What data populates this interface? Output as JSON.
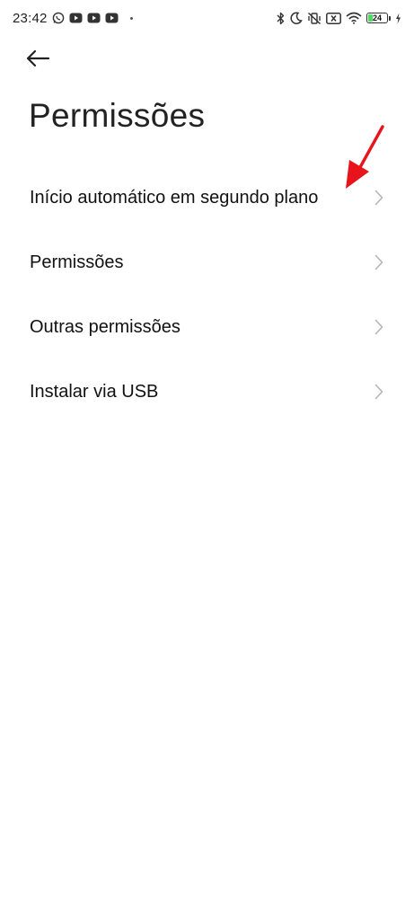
{
  "status_bar": {
    "time": "23:42",
    "battery_level": "24",
    "battery_fraction": 0.24,
    "left_icons": [
      "whatsapp-icon",
      "youtube-icon",
      "youtube-icon",
      "youtube-icon",
      "dot-icon"
    ],
    "right_icons": [
      "bluetooth-icon",
      "moon-icon",
      "vibrate-off-icon",
      "sim-off-icon",
      "wifi-icon",
      "battery-icon",
      "charging-icon"
    ]
  },
  "header": {
    "back_icon": "arrow-left-icon",
    "title": "Permissões"
  },
  "menu": {
    "items": [
      {
        "label": "Início automático em segundo plano"
      },
      {
        "label": "Permissões"
      },
      {
        "label": "Outras permissões"
      },
      {
        "label": "Instalar via USB"
      }
    ],
    "chevron_icon": "chevron-right-icon"
  },
  "annotation": {
    "arrow_color": "#e8141b",
    "points_to": "Início automático em segundo plano"
  },
  "colors": {
    "background": "#ffffff",
    "text": "#111111",
    "chevron": "#b5b5b5",
    "battery_fill": "#4cd964"
  }
}
